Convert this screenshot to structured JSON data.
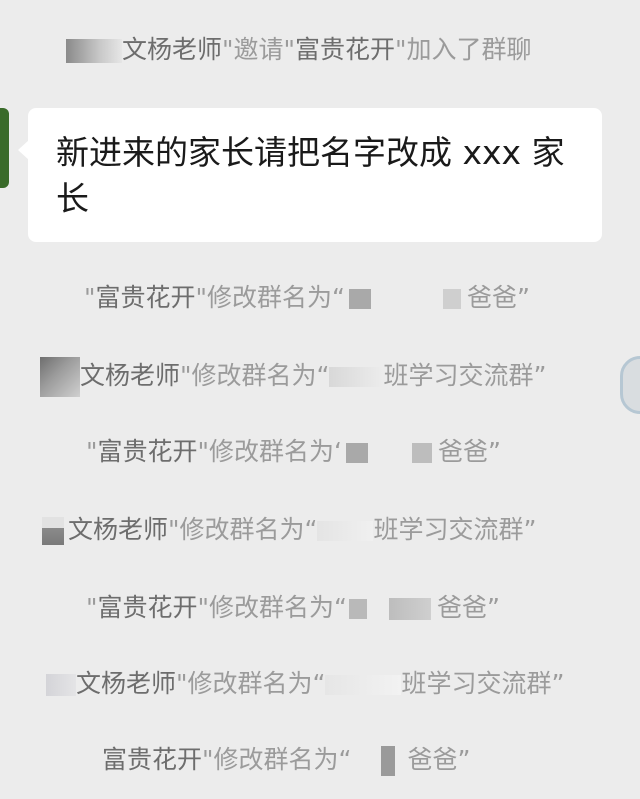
{
  "messages": [
    {
      "type": "system",
      "q1": "\"",
      "name1": "文杨老师",
      "q2": "\"",
      "verb": "邀请",
      "q3": "\"",
      "name2": "富贵花开",
      "q4": "\"",
      "tail": "加入了群聊"
    },
    {
      "type": "chat",
      "text": "新进来的家长请把名字改成 xxx 家长"
    },
    {
      "type": "system",
      "q1": "\"",
      "name": "富贵花开",
      "q2": "\"",
      "action": "修改群名为",
      "qopen": "“",
      "tail": "爸爸",
      "qclose": "”"
    },
    {
      "type": "system",
      "name": "文杨老师",
      "q2": "\"",
      "action": "修改群名为",
      "qopen": "“",
      "tail": "班学习交流群",
      "qclose": "”"
    },
    {
      "type": "system",
      "q1": "\"",
      "name": "富贵花开",
      "q2": "\"",
      "action": "修改群名为",
      "qopen": "‘",
      "tail": "爸爸",
      "qclose": "”"
    },
    {
      "type": "system",
      "name": "文杨老师",
      "q2": "\"",
      "action": "修改群名为",
      "qopen": "“",
      "tail": "班学习交流群",
      "qclose": "”"
    },
    {
      "type": "system",
      "q1": "\"",
      "name": "富贵花开",
      "q2": "\"",
      "action": "修改群名为",
      "qopen": "“",
      "tail": "爸爸",
      "qclose": "”"
    },
    {
      "type": "system",
      "name": "文杨老师",
      "q2": "\"",
      "action": "修改群名为",
      "qopen": "“",
      "tail": "班学习交流群",
      "qclose": "”"
    },
    {
      "type": "system",
      "name": "富贵花开",
      "q2": "\"",
      "action": "修改群名为",
      "qopen": "“",
      "tail": "爸爸",
      "qclose": "”"
    }
  ]
}
